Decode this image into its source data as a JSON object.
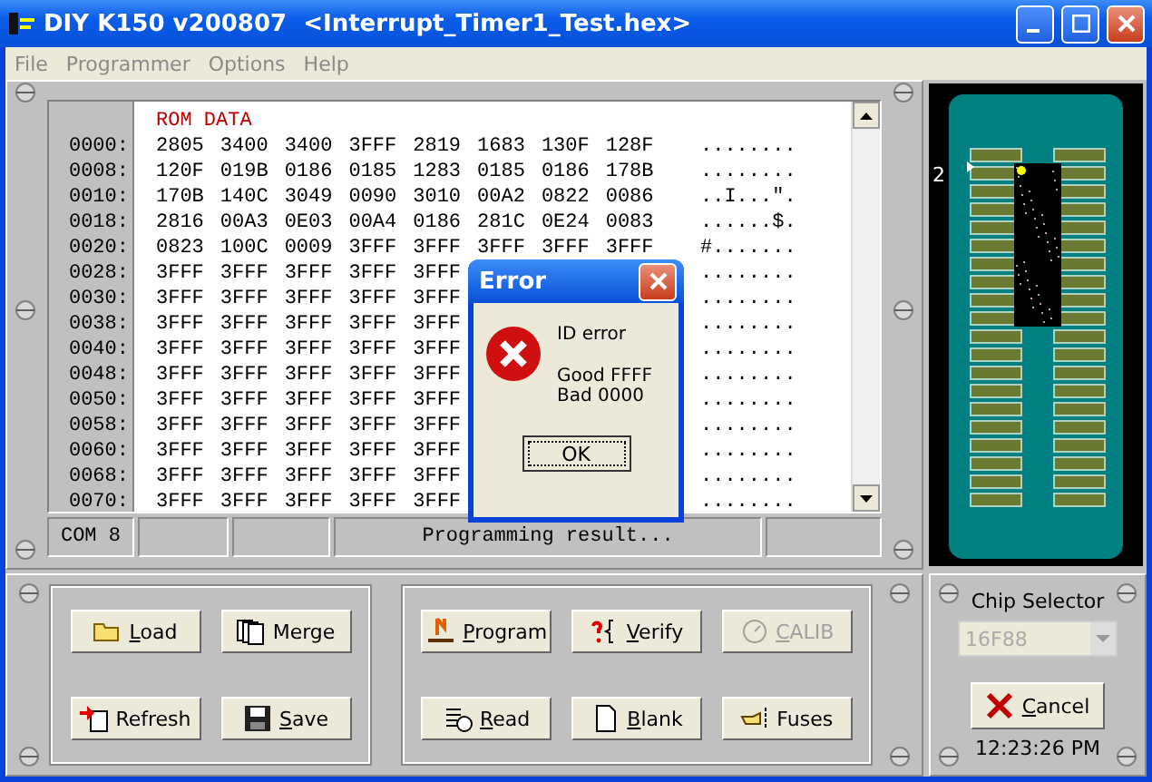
{
  "window": {
    "title": "DIY K150 v200807  <Interrupt_Timer1_Test.hex>"
  },
  "menu": [
    "File",
    "Programmer",
    "Options",
    "Help"
  ],
  "hex_view": {
    "header": "ROM DATA",
    "rows": [
      {
        "address": "0000:",
        "words": [
          "2805",
          "3400",
          "3400",
          "3FFF",
          "2819",
          "1683",
          "130F",
          "128F"
        ],
        "ascii": "........"
      },
      {
        "address": "0008:",
        "words": [
          "120F",
          "019B",
          "0186",
          "0185",
          "1283",
          "0185",
          "0186",
          "178B"
        ],
        "ascii": "........"
      },
      {
        "address": "0010:",
        "words": [
          "170B",
          "140C",
          "3049",
          "0090",
          "3010",
          "00A2",
          "0822",
          "0086"
        ],
        "ascii": "..I...\"."
      },
      {
        "address": "0018:",
        "words": [
          "2816",
          "00A3",
          "0E03",
          "00A4",
          "0186",
          "281C",
          "0E24",
          "0083"
        ],
        "ascii": "......$."
      },
      {
        "address": "0020:",
        "words": [
          "0823",
          "100C",
          "0009",
          "3FFF",
          "3FFF",
          "3FFF",
          "3FFF",
          "3FFF"
        ],
        "ascii": "#......."
      },
      {
        "address": "0028:",
        "words": [
          "3FFF",
          "3FFF",
          "3FFF",
          "3FFF",
          "3FFF"
        ],
        "ascii": "........"
      },
      {
        "address": "0030:",
        "words": [
          "3FFF",
          "3FFF",
          "3FFF",
          "3FFF",
          "3FFF"
        ],
        "ascii": "........"
      },
      {
        "address": "0038:",
        "words": [
          "3FFF",
          "3FFF",
          "3FFF",
          "3FFF",
          "3FFF"
        ],
        "ascii": "........"
      },
      {
        "address": "0040:",
        "words": [
          "3FFF",
          "3FFF",
          "3FFF",
          "3FFF",
          "3FFF"
        ],
        "ascii": "........"
      },
      {
        "address": "0048:",
        "words": [
          "3FFF",
          "3FFF",
          "3FFF",
          "3FFF",
          "3FFF"
        ],
        "ascii": "........"
      },
      {
        "address": "0050:",
        "words": [
          "3FFF",
          "3FFF",
          "3FFF",
          "3FFF",
          "3FFF"
        ],
        "ascii": "........"
      },
      {
        "address": "0058:",
        "words": [
          "3FFF",
          "3FFF",
          "3FFF",
          "3FFF",
          "3FFF"
        ],
        "ascii": "........"
      },
      {
        "address": "0060:",
        "words": [
          "3FFF",
          "3FFF",
          "3FFF",
          "3FFF",
          "3FFF"
        ],
        "ascii": "........"
      },
      {
        "address": "0068:",
        "words": [
          "3FFF",
          "3FFF",
          "3FFF",
          "3FFF",
          "3FFF"
        ],
        "ascii": "........"
      },
      {
        "address": "0070:",
        "words": [
          "3FFF",
          "3FFF",
          "3FFF",
          "3FFF",
          "3FFF"
        ],
        "ascii": "........"
      }
    ]
  },
  "status_bar": {
    "port": "COM 8",
    "message": "Programming result..."
  },
  "dialog": {
    "title": "Error",
    "message": "ID error",
    "detail": [
      "Good FFFF",
      "Bad 0000"
    ],
    "button": "OK"
  },
  "chip": {
    "pin_label": "2"
  },
  "file_buttons": [
    {
      "label": "Load",
      "kind": "folder",
      "underline_first": true,
      "disabled": false
    },
    {
      "label": "Merge",
      "kind": "pages",
      "underline_first": false,
      "disabled": false
    },
    {
      "label": "Refresh",
      "kind": "refresh",
      "underline_first": false,
      "disabled": false
    },
    {
      "label": "Save",
      "kind": "disk",
      "underline_first": true,
      "disabled": false
    }
  ],
  "action_buttons": [
    {
      "label": "Program",
      "kind": "program",
      "underline_first": true,
      "disabled": false
    },
    {
      "label": "Verify",
      "kind": "verify",
      "underline_first": true,
      "disabled": false
    },
    {
      "label": "CALIB",
      "kind": "calib",
      "underline_first": true,
      "disabled": true
    },
    {
      "label": "Read",
      "kind": "read",
      "underline_first": true,
      "disabled": false
    },
    {
      "label": "Blank",
      "kind": "blank",
      "underline_first": true,
      "disabled": false
    },
    {
      "label": "Fuses",
      "kind": "fuses",
      "underline_first": false,
      "disabled": false
    }
  ],
  "chip_selector": {
    "label": "Chip Selector",
    "value": "16F88",
    "disabled": true
  },
  "cancel_button": {
    "label": "Cancel",
    "underline_first": true
  },
  "clock": "12:23:26 PM"
}
